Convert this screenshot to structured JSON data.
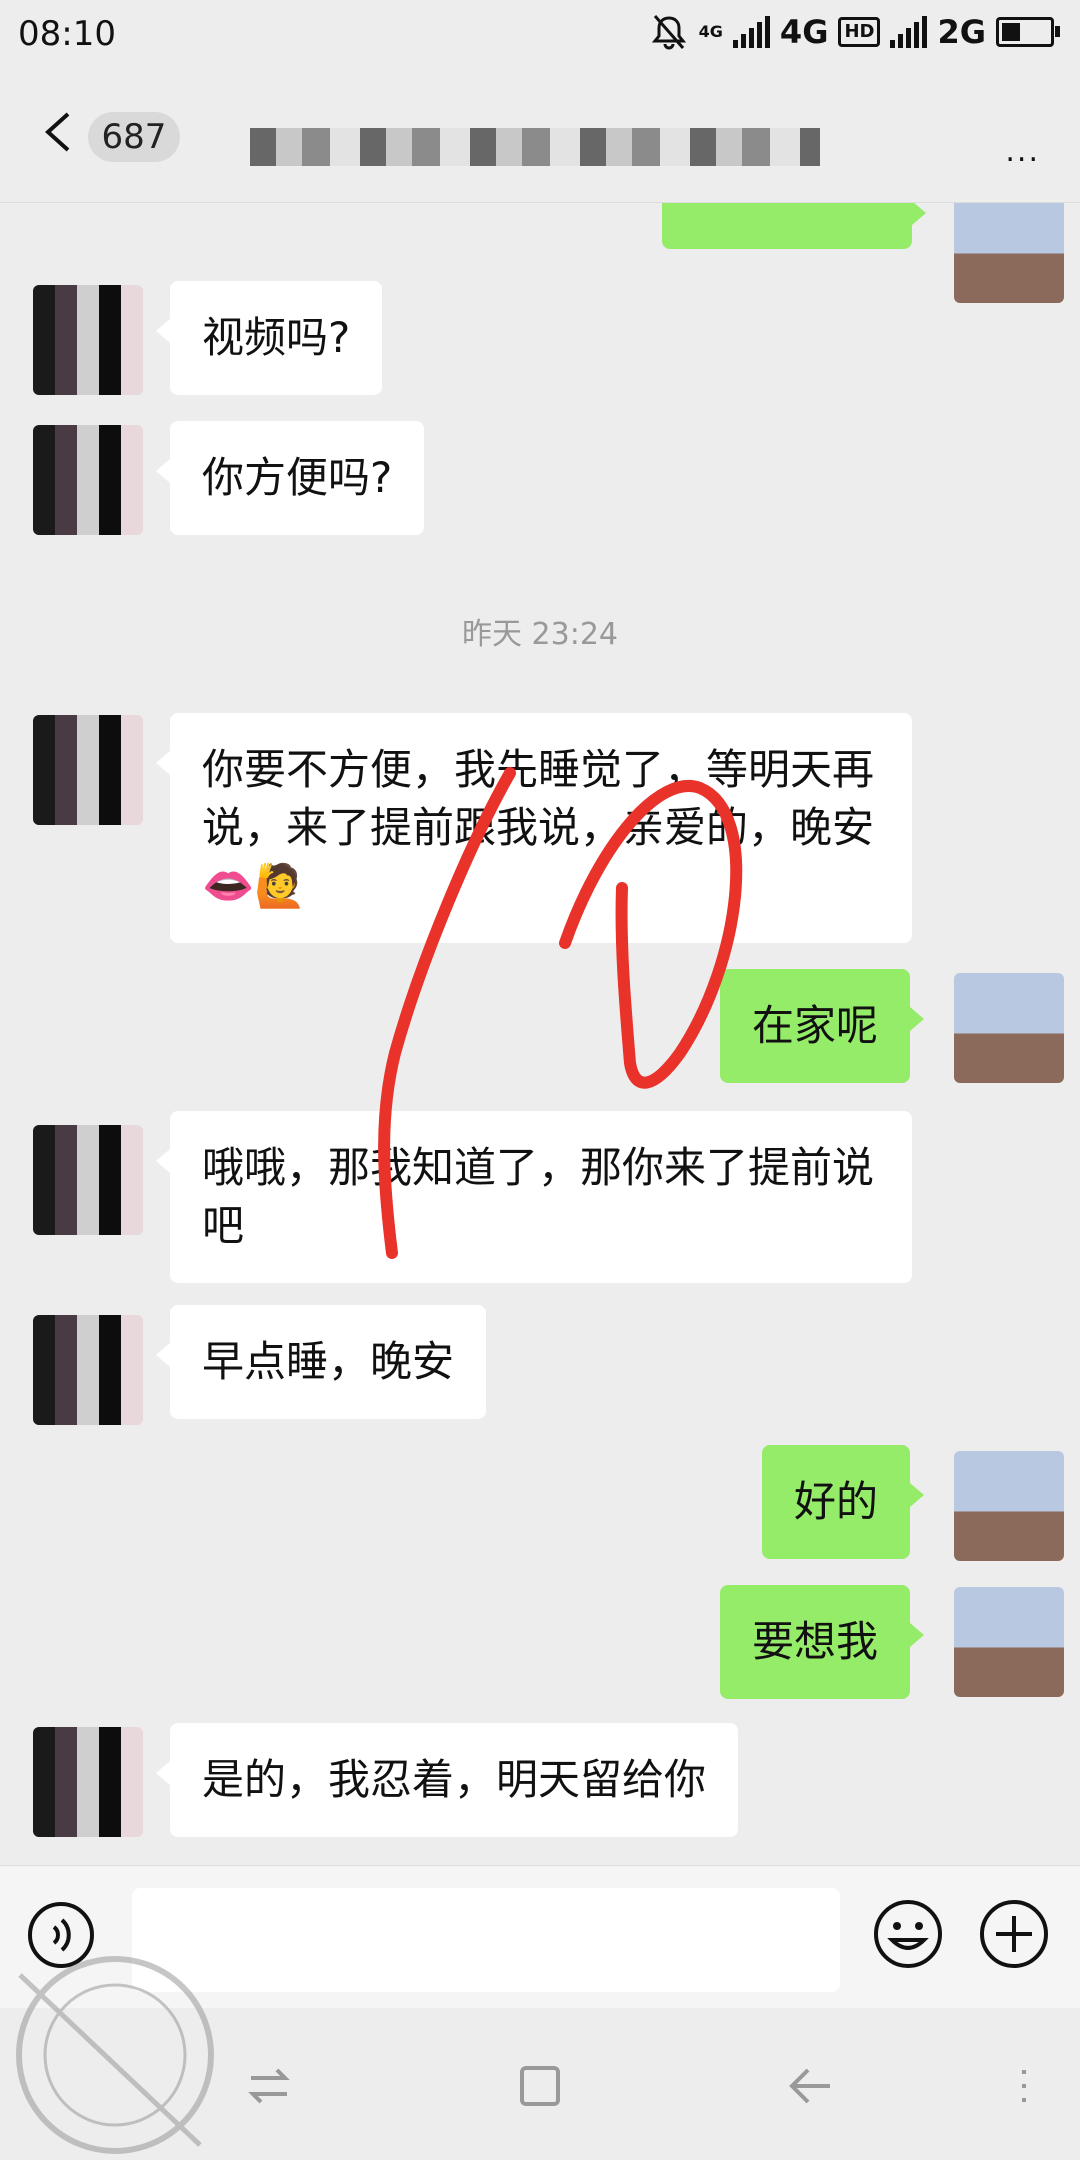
{
  "status_bar": {
    "time": "08:10",
    "network_1": "4G",
    "network_2": "2G",
    "hd": "HD",
    "lte_tag": "4G",
    "battery_level": 0.4
  },
  "header": {
    "unread_count": "687",
    "more_glyph": "..."
  },
  "messages": [
    {
      "text": "视频吗?"
    },
    {
      "text": "你方便吗?"
    },
    {
      "text": "你要不方便，我先睡觉了，等明天再说，来了提前跟我说，亲爱的，晚安👄🙋"
    },
    {
      "text": "在家呢"
    },
    {
      "text": "哦哦，那我知道了，那你来了提前说吧"
    },
    {
      "text": "早点睡，晚安"
    },
    {
      "text": "好的"
    },
    {
      "text": "要想我"
    },
    {
      "text": "是的，我忍着，明天留给你"
    }
  ],
  "timestamp": "昨天 23:24",
  "colors": {
    "background": "#ededed",
    "sent_bubble": "#95ec69",
    "received_bubble": "#ffffff",
    "scribble": "#e8322a"
  },
  "icons": [
    "back-icon",
    "voice-icon",
    "emoji-icon",
    "plus-icon",
    "nav-switch-icon",
    "nav-home-icon",
    "nav-back-icon",
    "nav-menu-icon"
  ]
}
